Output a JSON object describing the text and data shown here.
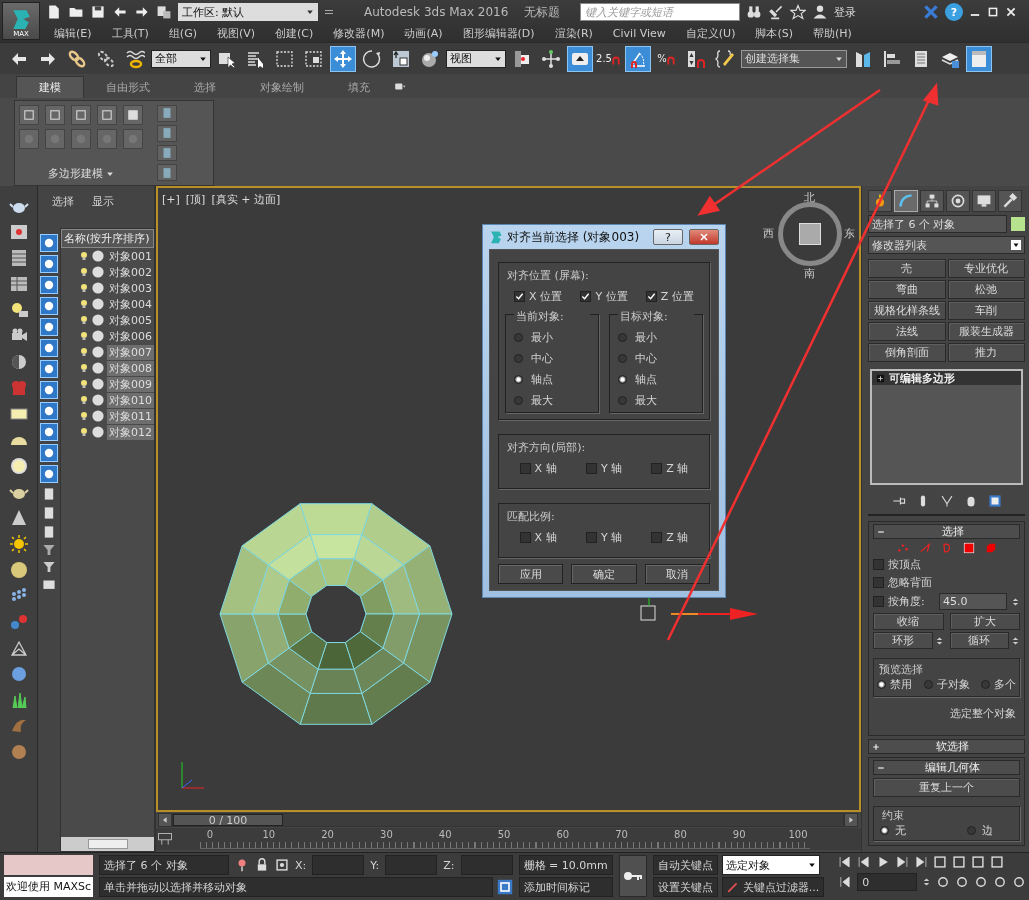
{
  "title_bar": {
    "app_label": "MAX",
    "workspace": "工作区: 默认",
    "title": "Autodesk 3ds Max 2016",
    "document": "无标题",
    "search_placeholder": "键入关键字或短语",
    "sign_in": "登录",
    "help": "?"
  },
  "menu": [
    "编辑(E)",
    "工具(T)",
    "组(G)",
    "视图(V)",
    "创建(C)",
    "修改器(M)",
    "动画(A)",
    "图形编辑器(D)",
    "渲染(R)",
    "Civil View",
    "自定义(U)",
    "脚本(S)",
    "帮助(H)"
  ],
  "main_toolbar": [
    {
      "kind": "undo",
      "on": false
    },
    {
      "kind": "redo",
      "on": false
    },
    {
      "kind": "link",
      "on": false
    },
    {
      "kind": "unlink",
      "on": false
    },
    {
      "kind": "bind",
      "on": false
    },
    {
      "kind": "dropdown",
      "value": "全部"
    },
    {
      "kind": "select",
      "on": false
    },
    {
      "kind": "select_by_name",
      "on": false
    },
    {
      "kind": "region",
      "on": false
    },
    {
      "kind": "crossing",
      "on": false
    },
    {
      "kind": "move",
      "on": true
    },
    {
      "kind": "rotate",
      "on": false
    },
    {
      "kind": "scale",
      "on": false
    },
    {
      "kind": "place",
      "on": false
    },
    {
      "kind": "dropdown",
      "value": "视图"
    },
    {
      "kind": "pivot",
      "on": false
    },
    {
      "kind": "manipulate",
      "on": false
    },
    {
      "kind": "keyboard",
      "on": true
    },
    {
      "kind": "snap",
      "label": "2.5",
      "on": false
    },
    {
      "kind": "angle_snap",
      "on": true
    },
    {
      "kind": "snap",
      "label": "%",
      "on": false
    },
    {
      "kind": "spinner_snap",
      "on": false
    },
    {
      "kind": "named_sets",
      "on": false
    },
    {
      "kind": "dropdown",
      "value": "创建选择集"
    },
    {
      "kind": "mirror",
      "on": false
    },
    {
      "kind": "align",
      "on": false
    },
    {
      "kind": "layers",
      "on": false
    },
    {
      "kind": "explorer",
      "on": false
    },
    {
      "kind": "ribbon",
      "on": true
    }
  ],
  "ribbon": {
    "tabs": [
      {
        "label": "建模",
        "selected": true
      },
      {
        "label": "自由形式",
        "selected": false
      },
      {
        "label": "选择",
        "selected": false
      },
      {
        "label": "对象绘制",
        "selected": false
      },
      {
        "label": "填充",
        "selected": false
      }
    ],
    "panel_label": "多边形建模"
  },
  "scene_explorer": {
    "tabs": [
      "选择",
      "显示"
    ],
    "column": "名称(按升序排序)",
    "rows": [
      {
        "name": "对象001",
        "selected": false
      },
      {
        "name": "对象002",
        "selected": false
      },
      {
        "name": "对象003",
        "selected": false
      },
      {
        "name": "对象004",
        "selected": false
      },
      {
        "name": "对象005",
        "selected": false
      },
      {
        "name": "对象006",
        "selected": false
      },
      {
        "name": "对象007",
        "selected": true
      },
      {
        "name": "对象008",
        "selected": true
      },
      {
        "name": "对象009",
        "selected": true
      },
      {
        "name": "对象010",
        "selected": true
      },
      {
        "name": "对象011",
        "selected": true
      },
      {
        "name": "对象012",
        "selected": true
      }
    ]
  },
  "viewport": {
    "labels": [
      "[+]",
      "[顶]",
      "[真实 + 边面]"
    ],
    "viewcube": {
      "north": "北",
      "south": "南",
      "east": "东",
      "west": "西"
    }
  },
  "dialog": {
    "title": "对齐当前选择 (对象003)",
    "help": "?",
    "position_title": "对齐位置 (屏幕):",
    "position_axes": [
      {
        "label": "X 位置",
        "checked": true
      },
      {
        "label": "Y 位置",
        "checked": true
      },
      {
        "label": "Z 位置",
        "checked": true
      }
    ],
    "current": {
      "title": "当前对象:",
      "options": [
        {
          "label": "最小",
          "selected": false
        },
        {
          "label": "中心",
          "selected": false
        },
        {
          "label": "轴点",
          "selected": true
        },
        {
          "label": "最大",
          "selected": false
        }
      ]
    },
    "target": {
      "title": "目标对象:",
      "options": [
        {
          "label": "最小",
          "selected": false
        },
        {
          "label": "中心",
          "selected": false
        },
        {
          "label": "轴点",
          "selected": true
        },
        {
          "label": "最大",
          "selected": false
        }
      ]
    },
    "orientation": {
      "title": "对齐方向(局部):",
      "axes": [
        {
          "label": "X 轴",
          "checked": false
        },
        {
          "label": "Y 轴",
          "checked": false
        },
        {
          "label": "Z 轴",
          "checked": false
        }
      ]
    },
    "scale": {
      "title": "匹配比例:",
      "axes": [
        {
          "label": "X 轴",
          "checked": false
        },
        {
          "label": "Y 轴",
          "checked": false
        },
        {
          "label": "Z 轴",
          "checked": false
        }
      ]
    },
    "buttons": [
      "应用",
      "确定",
      "取消"
    ]
  },
  "command_panel": {
    "tabs": [
      {
        "kind": "create",
        "selected": false
      },
      {
        "kind": "modify",
        "selected": true
      },
      {
        "kind": "hierarchy",
        "selected": false
      },
      {
        "kind": "motion",
        "selected": false
      },
      {
        "kind": "display",
        "selected": false
      },
      {
        "kind": "utilities",
        "selected": false
      }
    ],
    "object_name": "选择了 6 个 对象",
    "modifier_list": "修改器列表",
    "modifier_buttons": [
      "壳",
      "专业优化",
      "弯曲",
      "松弛",
      "规格化样条线",
      "车削",
      "法线",
      "服装生成器",
      "倒角剖面",
      "推力"
    ],
    "stack": [
      {
        "label": "可编辑多边形",
        "selected": true
      }
    ],
    "selection": {
      "title": "选择",
      "expanded": true,
      "options": [
        {
          "label": "按顶点",
          "checked": false
        },
        {
          "label": "忽略背面",
          "checked": false
        },
        {
          "label": "按角度:",
          "checked": false
        }
      ],
      "angle": "45.0",
      "buttons": [
        "收缩",
        "扩大",
        "环形",
        "循环"
      ],
      "preview": {
        "title": "预览选择",
        "options": [
          {
            "label": "禁用",
            "selected": true
          },
          {
            "label": "子对象",
            "selected": false
          },
          {
            "label": "多个",
            "selected": false
          }
        ]
      },
      "whole_object": "选定整个对象"
    },
    "soft_selection": {
      "title": "软选择",
      "expanded": false
    },
    "edit_geometry": {
      "title": "编辑几何体",
      "expanded": true,
      "repeat": "重复上一个",
      "constraint": {
        "title": "约束",
        "options": [
          {
            "label": "无",
            "selected": true
          },
          {
            "label": "边",
            "selected": false
          }
        ]
      }
    }
  },
  "timeline": {
    "position": "0 / 100",
    "level": 0,
    "ticks": [
      "0",
      "10",
      "20",
      "30",
      "40",
      "50",
      "60",
      "70",
      "80",
      "90",
      "100"
    ]
  },
  "status_bar": {
    "welcome": "欢迎使用 MAXSc",
    "selection": "选择了 6 个 对象",
    "prompt": "单击并拖动以选择并移动对象",
    "coords": [
      "X:",
      "Y:",
      "Z:"
    ],
    "grid": "栅格 = 10.0mm",
    "add_time_tag": "添加时间标记",
    "auto_key": "自动关键点",
    "key_mode": "选定对象",
    "set_key": "设置关键点",
    "key_filters": "关键点过滤器...",
    "frame": "0"
  }
}
